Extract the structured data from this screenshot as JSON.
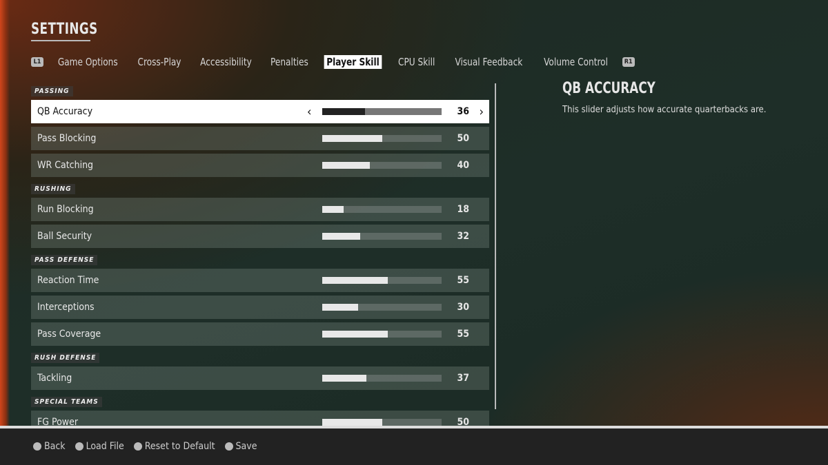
{
  "title": "SETTINGS",
  "tabs": {
    "left_bumper": "L1",
    "right_bumper": "R1",
    "items": [
      "Game Options",
      "Cross-Play",
      "Accessibility",
      "Penalties",
      "Player Skill",
      "CPU Skill",
      "Visual Feedback",
      "Volume Control"
    ],
    "active": "Player Skill"
  },
  "sections": [
    {
      "label": "PASSING",
      "rows": [
        {
          "label": "QB Accuracy",
          "value": 36,
          "selected": true
        },
        {
          "label": "Pass Blocking",
          "value": 50
        },
        {
          "label": "WR Catching",
          "value": 40
        }
      ]
    },
    {
      "label": "RUSHING",
      "rows": [
        {
          "label": "Run Blocking",
          "value": 18
        },
        {
          "label": "Ball Security",
          "value": 32
        }
      ]
    },
    {
      "label": "PASS DEFENSE",
      "rows": [
        {
          "label": "Reaction Time",
          "value": 55
        },
        {
          "label": "Interceptions",
          "value": 30
        },
        {
          "label": "Pass Coverage",
          "value": 55
        }
      ]
    },
    {
      "label": "RUSH DEFENSE",
      "rows": [
        {
          "label": "Tackling",
          "value": 37
        }
      ]
    },
    {
      "label": "SPECIAL TEAMS",
      "rows": [
        {
          "label": "FG Power",
          "value": 50
        }
      ]
    }
  ],
  "slider_max": 100,
  "detail": {
    "title": "QB ACCURACY",
    "description": "This slider adjusts how accurate quarterbacks are."
  },
  "footer": [
    {
      "icon": "circle-button-icon",
      "label": "Back"
    },
    {
      "icon": "square-button-icon",
      "label": "Load File"
    },
    {
      "icon": "triangle-button-icon",
      "label": "Reset to Default"
    },
    {
      "icon": "touchpad-button-icon",
      "label": "Save"
    }
  ]
}
